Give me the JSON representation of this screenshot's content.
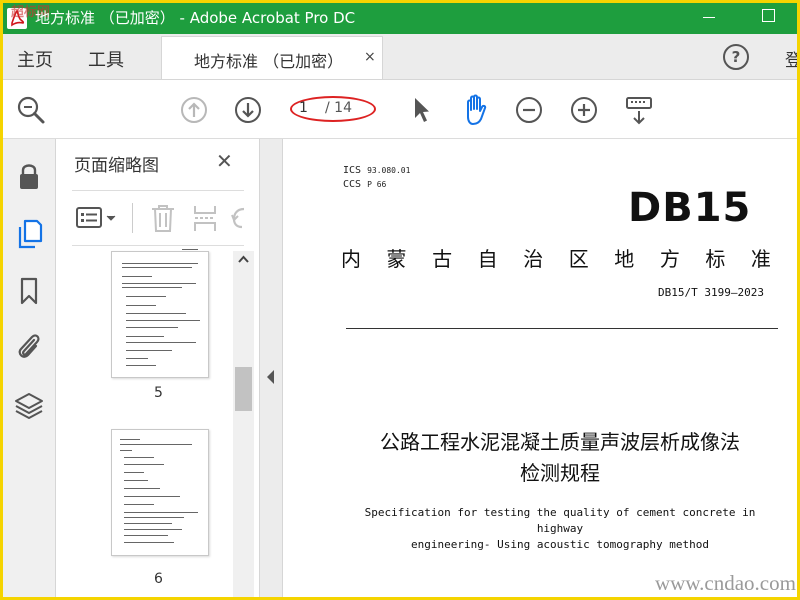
{
  "window": {
    "title": "地方标准 （已加密） - Adobe Acrobat Pro DC",
    "corner_watermark": "超标网"
  },
  "tabs": {
    "home": "主页",
    "tools": "工具",
    "document_tab": "地方标准 （已加密）",
    "close_glyph": "×",
    "help_glyph": "?",
    "signin_partial": "登"
  },
  "toolbar": {
    "page_current": "1",
    "page_total": "/ 14"
  },
  "panel": {
    "title": "页面缩略图",
    "close_glyph": "✕",
    "thumbnails": [
      {
        "label": "5"
      },
      {
        "label": "6"
      }
    ]
  },
  "document": {
    "ics_label": "ICS",
    "ics_value": "93.080.01",
    "ccs_label": "CCS",
    "ccs_value": "P 66",
    "logo": "DB15",
    "standard_type_chars": [
      "内",
      "蒙",
      "古",
      "自",
      "治",
      "区",
      "地",
      "方",
      "标",
      "准"
    ],
    "code": "DB15/T 3199—2023",
    "title_cn_line1": "公路工程水泥混凝土质量声波层析成像法",
    "title_cn_line2": "检测规程",
    "title_en_line1": "Specification for testing the quality of cement concrete in highway",
    "title_en_line2": "engineering- Using acoustic tomography method"
  },
  "watermark": "www.cndao.com",
  "colors": {
    "titlebar": "#1e9e3e",
    "frame": "#f5d400",
    "accent_blue": "#1473e6",
    "annotation_red": "#dd2222"
  },
  "icons": {
    "zoom": "zoom-search-icon",
    "prev": "arrow-up-circle-icon",
    "next": "arrow-down-circle-icon",
    "select": "arrow-cursor-icon",
    "hand": "hand-icon",
    "zoom_out": "minus-circle-icon",
    "zoom_in": "plus-circle-icon",
    "keyboard": "keyboard-icon"
  }
}
